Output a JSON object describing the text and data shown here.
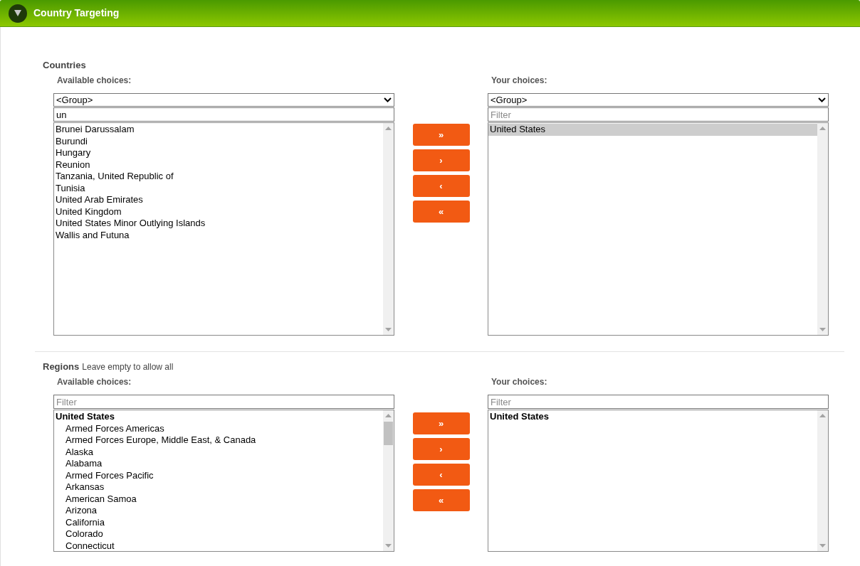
{
  "header": {
    "title": "Country Targeting",
    "expanded": true
  },
  "sections": [
    {
      "title": "Countries",
      "available": {
        "label": "Available choices:",
        "group_select": "<Group>",
        "filter": {
          "value": "un"
        },
        "items": [
          {
            "label": "Brunei Darussalam",
            "kind": "option",
            "selected": false
          },
          {
            "label": "Burundi",
            "kind": "option",
            "selected": false
          },
          {
            "label": "Hungary",
            "kind": "option",
            "selected": false
          },
          {
            "label": "Reunion",
            "kind": "option",
            "selected": false
          },
          {
            "label": "Tanzania, United Republic of",
            "kind": "option",
            "selected": false
          },
          {
            "label": "Tunisia",
            "kind": "option",
            "selected": false
          },
          {
            "label": "United Arab Emirates",
            "kind": "option",
            "selected": false
          },
          {
            "label": "United Kingdom",
            "kind": "option",
            "selected": false
          },
          {
            "label": "United States Minor Outlying Islands",
            "kind": "option",
            "selected": false
          },
          {
            "label": "Wallis and Futuna",
            "kind": "option",
            "selected": false
          }
        ]
      },
      "buttons": [
        "»",
        "›",
        "‹",
        "«"
      ],
      "chosen": {
        "label": "Your choices:",
        "group_select": "<Group>",
        "filter": {
          "placeholder": "Filter"
        },
        "items": [
          {
            "label": "United States",
            "kind": "option",
            "selected": true
          }
        ]
      }
    },
    {
      "title": "Regions",
      "hint": "Leave empty to allow all",
      "available": {
        "label": "Available choices:",
        "filter": {
          "placeholder": "Filter"
        },
        "items": [
          {
            "label": "United States",
            "kind": "group",
            "selected": false,
            "children": [
              {
                "label": "Armed Forces Americas",
                "kind": "option",
                "selected": false
              },
              {
                "label": "Armed Forces Europe, Middle East, & Canada",
                "kind": "option",
                "selected": false
              },
              {
                "label": "Alaska",
                "kind": "option",
                "selected": false
              },
              {
                "label": "Alabama",
                "kind": "option",
                "selected": false
              },
              {
                "label": "Armed Forces Pacific",
                "kind": "option",
                "selected": false
              },
              {
                "label": "Arkansas",
                "kind": "option",
                "selected": false
              },
              {
                "label": "American Samoa",
                "kind": "option",
                "selected": false
              },
              {
                "label": "Arizona",
                "kind": "option",
                "selected": false
              },
              {
                "label": "California",
                "kind": "option",
                "selected": false
              },
              {
                "label": "Colorado",
                "kind": "option",
                "selected": false
              },
              {
                "label": "Connecticut",
                "kind": "option",
                "selected": false
              }
            ]
          }
        ]
      },
      "buttons": [
        "»",
        "›",
        "‹",
        "«"
      ],
      "chosen": {
        "label": "Your choices:",
        "filter": {
          "placeholder": "Filter"
        },
        "items": [
          {
            "label": "United States",
            "kind": "group",
            "selected": false
          }
        ]
      }
    }
  ]
}
